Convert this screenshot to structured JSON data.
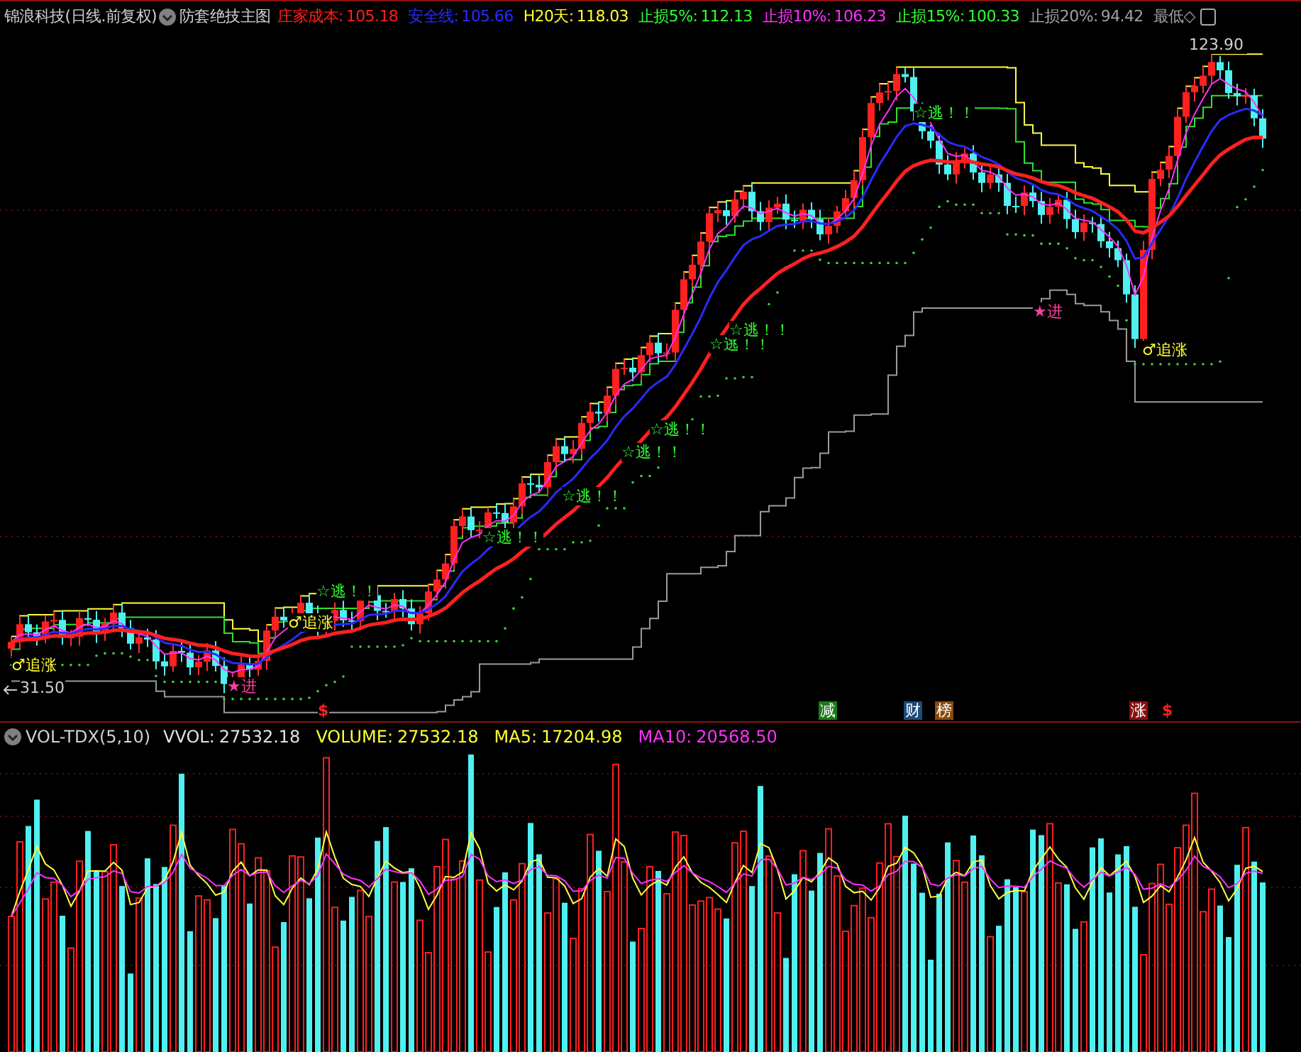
{
  "header": {
    "title": "锦浪科技(日线.前复权)",
    "indicator": "防套绝技主图",
    "items": [
      {
        "label": "庄家成本:",
        "value": "105.18",
        "color": "#ff2020"
      },
      {
        "label": "安全线:",
        "value": "105.66",
        "color": "#2a2aff"
      },
      {
        "label": "H20天:",
        "value": "118.03",
        "color": "#ffff30"
      },
      {
        "label": "止损5%:",
        "value": "112.13",
        "color": "#30ff30"
      },
      {
        "label": "止损10%:",
        "value": "106.23",
        "color": "#ff30ff"
      },
      {
        "label": "止损15%:",
        "value": "100.33",
        "color": "#30ff30"
      },
      {
        "label": "止损20%:",
        "value": "94.42",
        "color": "#a0a0a0"
      }
    ],
    "tail": "最低◇"
  },
  "price_labels": {
    "high": "123.90",
    "low": "31.50"
  },
  "annotations": [
    {
      "text": "♂追涨",
      "kind": "chase"
    },
    {
      "text": "★进",
      "kind": "buy"
    },
    {
      "text": "♂追涨",
      "kind": "chase"
    },
    {
      "text": "☆逃！！",
      "kind": "escape"
    },
    {
      "text": "☆逃！！",
      "kind": "escape"
    },
    {
      "text": "☆逃！！",
      "kind": "escape"
    },
    {
      "text": "☆逃！！",
      "kind": "escape"
    },
    {
      "text": "☆逃！！",
      "kind": "escape"
    },
    {
      "text": "☆逃！！",
      "kind": "escape"
    },
    {
      "text": "☆逃！！",
      "kind": "escape"
    },
    {
      "text": "☆逃！！",
      "kind": "escape"
    },
    {
      "text": "★进",
      "kind": "buy"
    },
    {
      "text": "♂追涨",
      "kind": "chase"
    }
  ],
  "markers": [
    {
      "text": "$",
      "kind": "sign",
      "color": "#ff2020"
    },
    {
      "text": "减",
      "kind": "badge",
      "color": "#1a7a1a"
    },
    {
      "text": "财",
      "kind": "badge",
      "color": "#1c4a7a"
    },
    {
      "text": "榜",
      "kind": "badge",
      "color": "#8a4a10"
    },
    {
      "text": "涨",
      "kind": "badge",
      "color": "#8a1010"
    },
    {
      "text": "$",
      "kind": "sign",
      "color": "#ff2020"
    }
  ],
  "volume_header": {
    "name": "VOL-TDX(5,10)",
    "items": [
      {
        "label": "VVOL:",
        "value": "27532.18",
        "color": "#e0e0e0"
      },
      {
        "label": "VOLUME:",
        "value": "27532.18",
        "color": "#ffff30"
      },
      {
        "label": "MA5:",
        "value": "17204.98",
        "color": "#ffff30"
      },
      {
        "label": "MA10:",
        "value": "20568.50",
        "color": "#ff30ff"
      }
    ]
  }
}
